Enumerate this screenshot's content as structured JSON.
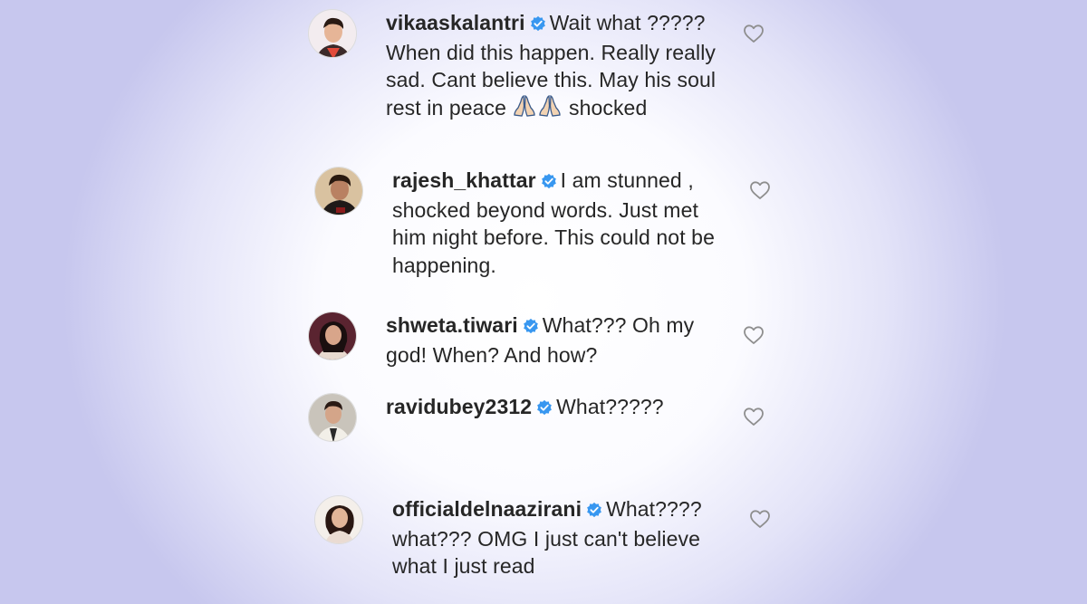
{
  "comments": [
    {
      "username": "vikaaskalantri",
      "text_pre": "Wait what ????? When did this happen. Really really sad. Cant believe this. May his soul rest in peace ",
      "emoji_icons": [
        "folded-hands-icon",
        "folded-hands-icon"
      ],
      "text_post": " shocked",
      "verified": true,
      "liked": false
    },
    {
      "username": "rajesh_khattar",
      "text": "I am stunned , shocked beyond words. Just met him night before. This could not be happening.",
      "verified": true,
      "liked": false
    },
    {
      "username": "shweta.tiwari",
      "text": "What??? Oh my god! When? And how?",
      "verified": true,
      "liked": false
    },
    {
      "username": "ravidubey2312",
      "text": "What?????",
      "verified": true,
      "liked": false
    },
    {
      "username": "officialdelnaazirani",
      "text": "What???? what??? OMG I just can't believe what I just read",
      "verified": true,
      "liked": false
    }
  ],
  "colors": {
    "verified_badge": "#3897f0",
    "text": "#262626",
    "heart_outline": "#8e8e8e"
  }
}
